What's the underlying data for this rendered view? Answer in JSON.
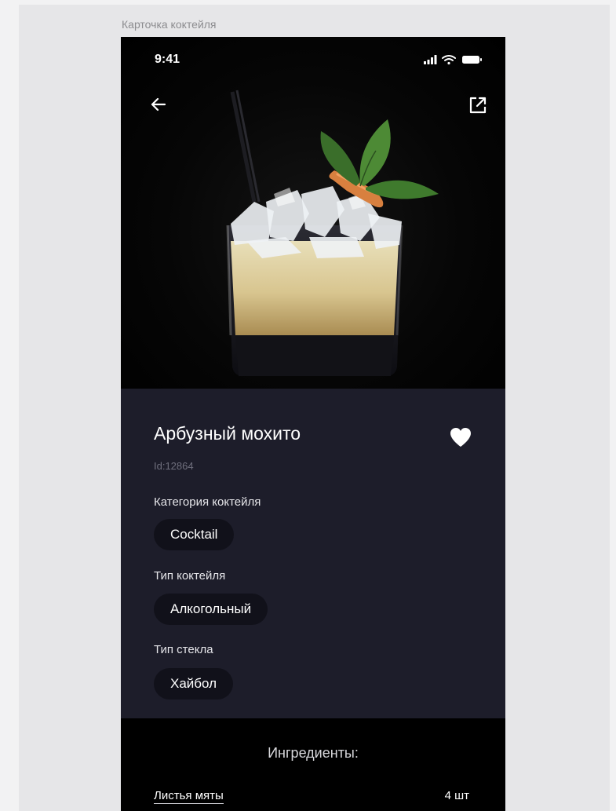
{
  "frame_label": "Карточка коктейля",
  "status_bar": {
    "time": "9:41"
  },
  "cocktail": {
    "name": "Арбузный мохито",
    "id_text": "Id:12864",
    "category_label": "Категория коктейля",
    "category_value": "Cocktail",
    "type_label": "Тип коктейля",
    "type_value": "Алкогольный",
    "glass_label": "Тип стекла",
    "glass_value": "Хайбол"
  },
  "ingredients": {
    "heading": "Ингредиенты:",
    "items": [
      {
        "name": "Листья мяты",
        "amount": "4 шт"
      }
    ]
  },
  "icons": {
    "back": "back-arrow-icon",
    "share": "share-icon",
    "favorite": "heart-icon",
    "signal": "cellular-signal-icon",
    "wifi": "wifi-icon",
    "battery": "battery-icon"
  },
  "colors": {
    "hero_background": "#000000",
    "info_background": "#1d1d2a",
    "chip_background": "#11111a",
    "text_primary": "#ffffff",
    "text_secondary": "#6f6f7d"
  }
}
